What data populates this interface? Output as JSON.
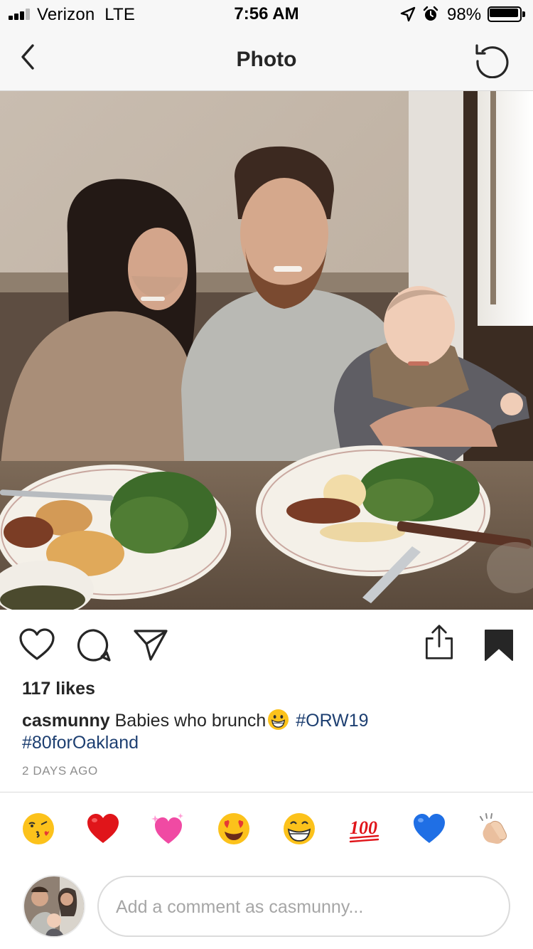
{
  "status_bar": {
    "carrier": "Verizon",
    "network": "LTE",
    "time": "7:56 AM",
    "battery_percent": "98%",
    "signal_bars": 3,
    "signal_bars_total": 4,
    "icons": [
      "signal-icon",
      "location-arrow-icon",
      "alarm-clock-icon",
      "battery-icon"
    ]
  },
  "nav": {
    "title": "Photo",
    "back_icon": "chevron-left-icon",
    "refresh_icon": "refresh-icon"
  },
  "post": {
    "actions": {
      "like_icon": "heart-outline-icon",
      "comment_icon": "comment-bubble-icon",
      "share_icon": "paper-plane-icon",
      "upload_icon": "share-upload-icon",
      "save_icon": "bookmark-filled-icon"
    },
    "likes": "117 likes",
    "caption": {
      "username": "casmunny",
      "text": "Babies who brunch",
      "emoji": "grinning-face-emoji",
      "hashtags": [
        "#ORW19",
        "#80forOakland"
      ]
    },
    "timestamp": "2 DAYS AGO"
  },
  "quick_emojis": [
    "kissing-face-emoji",
    "red-heart-emoji",
    "sparkling-heart-emoji",
    "heart-eyes-emoji",
    "grinning-face-emoji",
    "hundred-points-emoji",
    "blue-heart-emoji",
    "clapping-hands-emoji"
  ],
  "comment": {
    "placeholder": "Add a comment as casmunny..."
  },
  "colors": {
    "text": "#262626",
    "hashtag": "#1d3f71",
    "muted": "#8e8e8e",
    "bar_bg": "#f7f7f7",
    "border": "#dbdbdb"
  }
}
